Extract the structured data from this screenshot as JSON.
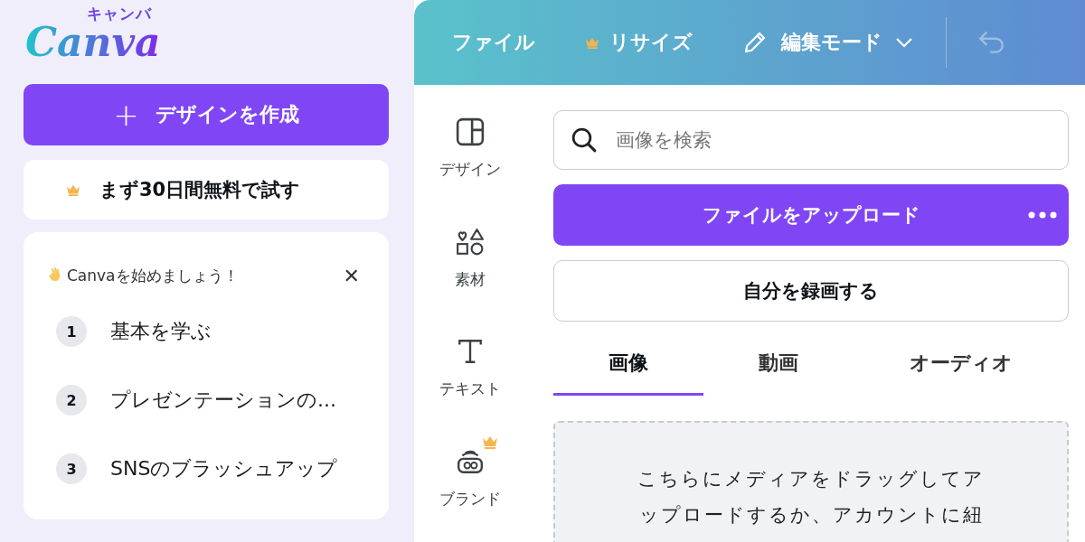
{
  "logo": {
    "wordmark": "Canva",
    "subtitle": "キャンバ"
  },
  "create_button": {
    "icon": "+",
    "label": "デザインを作成"
  },
  "trial_button": {
    "label": "まず30日間無料で試す",
    "premium": true
  },
  "onboarding": {
    "title": "Canvaを始めましょう！",
    "close": "✕",
    "steps": [
      {
        "number": "1",
        "label": "基本を学ぶ"
      },
      {
        "number": "2",
        "label": "プレゼンテーションの..."
      },
      {
        "number": "3",
        "label": "SNSのブラッシュアップ"
      }
    ]
  },
  "toolbar": {
    "items": [
      {
        "kind": "text",
        "label": "ファイル",
        "premium": false
      },
      {
        "kind": "text",
        "label": "リサイズ",
        "premium": true
      },
      {
        "kind": "mode",
        "label": "編集モード",
        "premium": false
      }
    ],
    "undo_disabled": true
  },
  "rail": [
    {
      "kind": "design",
      "label": "デザイン",
      "premium": false
    },
    {
      "kind": "elements",
      "label": "素材",
      "premium": false
    },
    {
      "kind": "text",
      "label": "テキスト",
      "premium": false
    },
    {
      "kind": "brand",
      "label": "ブランド",
      "premium": true
    }
  ],
  "search": {
    "placeholder": "画像を検索"
  },
  "upload_button": {
    "label": "ファイルをアップロード"
  },
  "record_button": {
    "label": "自分を録画する"
  },
  "tabs": [
    {
      "label": "画像",
      "selected": true
    },
    {
      "label": "動画",
      "selected": false
    },
    {
      "label": "オーディオ",
      "selected": false
    }
  ],
  "dropzone": {
    "text": "こちらにメディアをドラッグしてアップロードするか、アカウントに紐"
  }
}
